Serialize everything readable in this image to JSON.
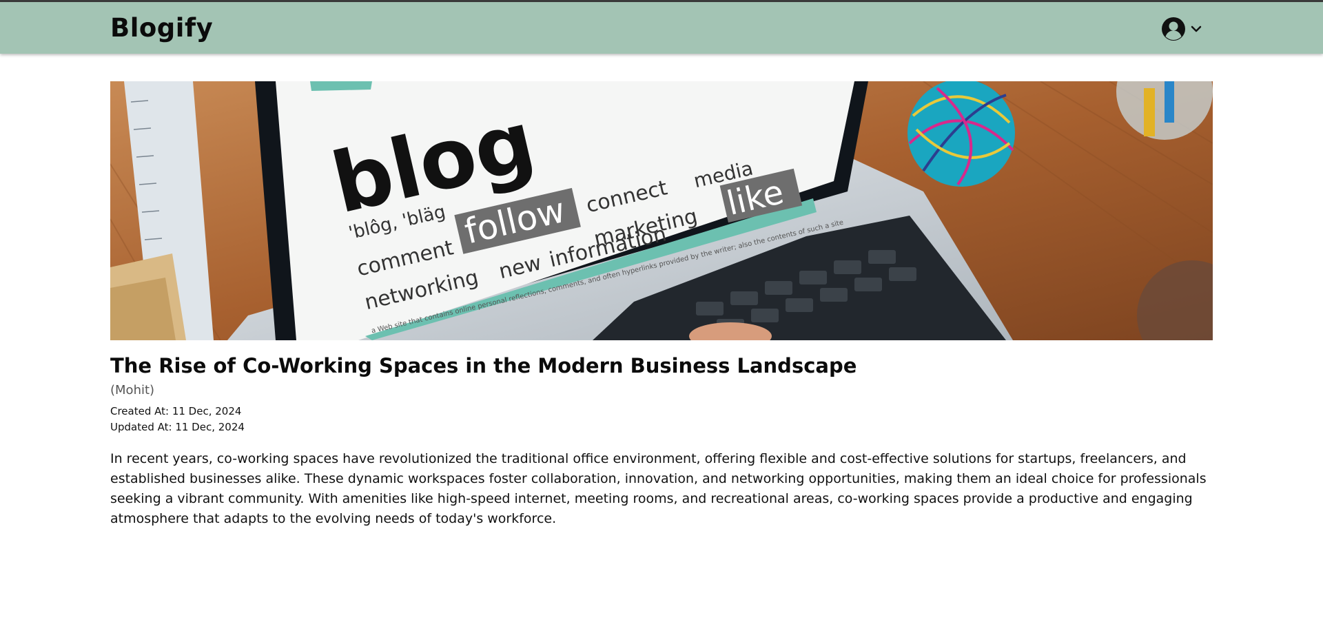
{
  "app": {
    "brand": "Blogify"
  },
  "header": {
    "user_icon": "user-circle-icon",
    "dropdown_icon": "chevron-down-icon"
  },
  "post": {
    "cover_image_text": {
      "headline": "blog",
      "pronunciation": "'blôg, 'bläg",
      "words": [
        "comment",
        "follow",
        "connect",
        "media",
        "marketing",
        "like",
        "networking",
        "new",
        "information"
      ],
      "definition": "a Web site that contains online personal reflections, comments, and often hyperlinks provided by the writer; also the contents of such a site"
    },
    "title": "The Rise of Co-Working Spaces in the Modern Business Landscape",
    "author": "(Mohit)",
    "created_at": "Created At: 11 Dec, 2024",
    "updated_at": "Updated At: 11 Dec, 2024",
    "body": "In recent years, co-working spaces have revolutionized the traditional office environment, offering flexible and cost-effective solutions for startups, freelancers, and established businesses alike. These dynamic workspaces foster collaboration, innovation, and networking opportunities, making them an ideal choice for professionals seeking a vibrant community. With amenities like high-speed internet, meeting rooms, and recreational areas, co-working spaces provide a productive and engaging atmosphere that adapts to the evolving needs of today's workforce."
  },
  "colors": {
    "navbar": "#a3c4b4",
    "topline": "#3b3b3b",
    "accent_teal": "#6cc0b0",
    "desk_wood": "#b06d3b"
  }
}
